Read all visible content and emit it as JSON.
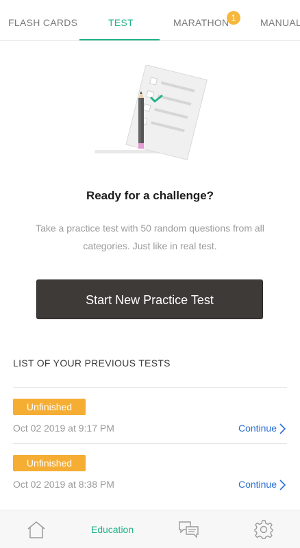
{
  "tabs": [
    {
      "label": "FLASH CARDS",
      "active": false
    },
    {
      "label": "TEST",
      "active": true
    },
    {
      "label": "MARATHON",
      "active": false,
      "badge": "1"
    },
    {
      "label": "MANUAL",
      "active": false
    }
  ],
  "main": {
    "headline": "Ready for a challenge?",
    "description": "Take a practice test with 50 random questions from all categories. Just like in real test.",
    "start_button": "Start New Practice Test"
  },
  "previous_tests": {
    "title": "LIST OF YOUR PREVIOUS TESTS",
    "items": [
      {
        "status": "Unfinished",
        "date": "Oct 02 2019 at 9:17 PM",
        "action": "Continue"
      },
      {
        "status": "Unfinished",
        "date": "Oct 02 2019 at 8:38 PM",
        "action": "Continue"
      }
    ]
  },
  "bottom_nav": {
    "items": [
      {
        "icon": "home-icon"
      },
      {
        "label": "Education",
        "active": true
      },
      {
        "icon": "chat-icon"
      },
      {
        "icon": "gear-icon"
      }
    ]
  },
  "colors": {
    "accent": "#22b38a",
    "badge": "#f6b73c",
    "unfinished": "#f5ad33",
    "link": "#2a6fd6",
    "button": "#3d3a38"
  }
}
